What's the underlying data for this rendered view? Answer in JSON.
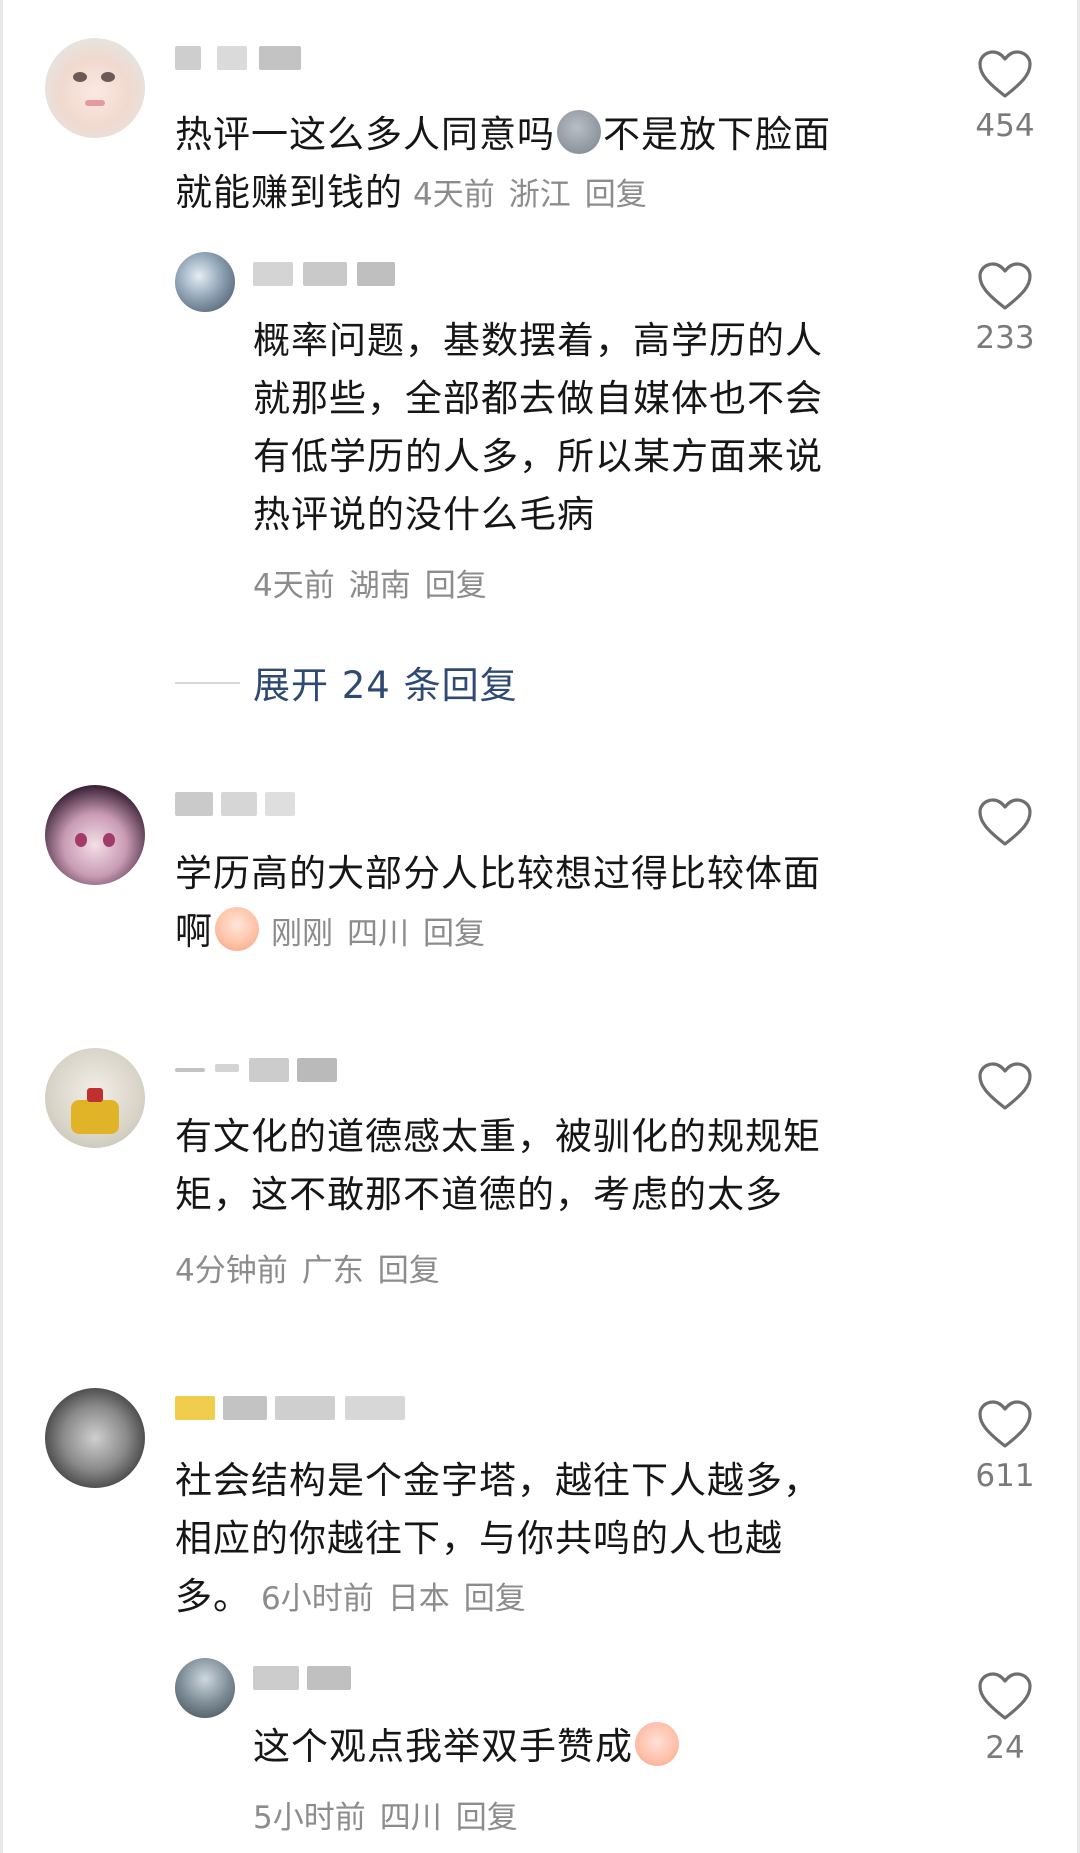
{
  "comments": [
    {
      "text": "热评一这么多人同意吗",
      "text_tail": "不是放下脸面",
      "text_line2": "就能赚到钱的",
      "emoji": "grimace-ghost-emoji",
      "meta": {
        "time": "4天前",
        "location": "浙江",
        "reply": "回复"
      },
      "likes": "454",
      "replies": [
        {
          "lines": [
            "概率问题，基数摆着，高学历的人",
            "就那些，全部都去做自媒体也不会",
            "有低学历的人多，所以某方面来说",
            "热评说的没什么毛病"
          ],
          "meta": {
            "time": "4天前",
            "location": "湖南",
            "reply": "回复"
          },
          "likes": "233"
        }
      ],
      "expand_label": "展开 24 条回复"
    },
    {
      "text": "学历高的大部分人比较想过得比较体面",
      "text_line2": "啊",
      "emoji": "crying-laughing-emoji",
      "meta": {
        "time": "刚刚",
        "location": "四川",
        "reply": "回复"
      },
      "likes": ""
    },
    {
      "lines": [
        "有文化的道德感太重，被驯化的规规矩",
        "矩，这不敢那不道德的，考虑的太多"
      ],
      "meta": {
        "time": "4分钟前",
        "location": "广东",
        "reply": "回复"
      },
      "likes": ""
    },
    {
      "lines": [
        "社会结构是个金字塔，越往下人越多，",
        "相应的你越往下，与你共鸣的人也越"
      ],
      "text_line3": "多。",
      "meta": {
        "time": "6小时前",
        "location": "日本",
        "reply": "回复"
      },
      "likes": "611",
      "replies": [
        {
          "text": "这个观点我举双手赞成",
          "emoji": "peach-face-emoji",
          "meta": {
            "time": "5小时前",
            "location": "四川",
            "reply": "回复"
          },
          "likes": "24"
        }
      ]
    }
  ],
  "colors": {
    "text": "#161616",
    "meta": "#8c8c8c",
    "expand": "#2f4a72",
    "heart": "#6e6e6e"
  }
}
